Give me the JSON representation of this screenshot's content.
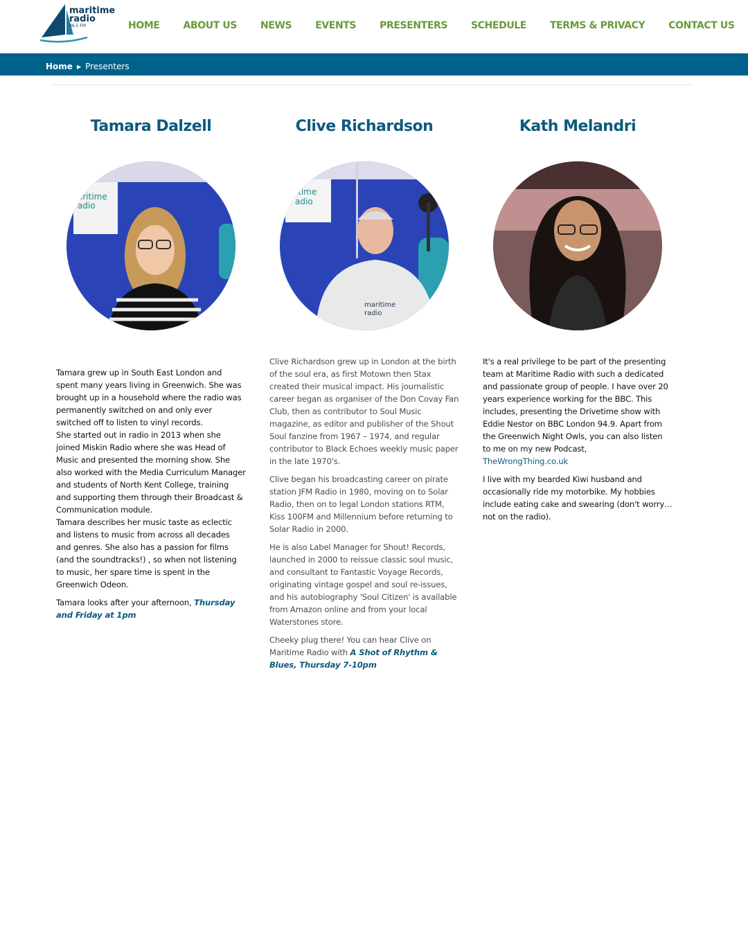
{
  "site": {
    "logo": {
      "line1": "maritime",
      "line2": "radio",
      "freq": "96.5 FM"
    },
    "nav": [
      "HOME",
      "ABOUT US",
      "NEWS",
      "EVENTS",
      "PRESENTERS",
      "SCHEDULE",
      "TERMS & PRIVACY",
      "CONTACT US"
    ],
    "colors": {
      "nav_green": "#6a9a3a",
      "bar_blue": "#00628a",
      "heading_blue": "#0d5a7e"
    }
  },
  "breadcrumb": {
    "home": "Home",
    "current": "Presenters"
  },
  "presenters": [
    {
      "name": "Tamara Dalzell",
      "lines": [
        "Tamara grew up in South East London and spent many years living in Greenwich. She was brought up in a household where the radio was permanently switched on and only ever switched off to listen to vinyl records.",
        "She started out in radio in 2013 when she joined Miskin Radio where she was Head of Music and presented the morning show. She also worked with the Media Curriculum Manager and students of North Kent College, training and supporting them through their Broadcast & Communication module.",
        "Tamara describes her music taste as eclectic and listens to music from across all decades and genres. She also has a passion for films (and the soundtracks!) , so when not listening to music, her spare time is spent in the Greenwich Odeon."
      ],
      "closing_text": "Tamara looks after your afternoon, ",
      "closing_link": "Thursday and Friday at 1pm"
    },
    {
      "name": "Clive Richardson",
      "paragraphs": [
        "Clive Richardson grew up in London at the birth of the soul era, as first Motown then Stax created their musical impact. His journalistic career began as organiser of the Don Covay Fan Club, then as contributor to Soul Music magazine, as editor and publisher of the Shout Soul fanzine from 1967 – 1974, and regular contributor to Black Echoes weekly music paper in the late 1970's.",
        "Clive began his broadcasting career on pirate station JFM Radio in 1980, moving on to Solar Radio, then on to legal London stations RTM, Kiss 100FM and Millennium before returning to Solar Radio in 2000.",
        "He is also Label Manager for Shout! Records, launched in 2000 to reissue classic soul music, and consultant to Fantastic Voyage Records, originating vintage gospel and soul re-issues, and his autobiography 'Soul Citizen' is available from Amazon online and from your local Waterstones store."
      ],
      "closing_text": "Cheeky plug there!  You can hear Clive on Maritime Radio with ",
      "closing_link": "A Shot of Rhythm & Blues, Thursday 7-10pm"
    },
    {
      "name": "Kath Melandri",
      "p1_text": "It's a real privilege to be part of the presenting team at Maritime Radio with such a dedicated and passionate group of people. I have over 20 years experience working for the BBC. This includes, presenting the Drivetime show with Eddie Nestor on BBC London 94.9. Apart from the Greenwich Night Owls, you can also listen to me on my new Podcast, ",
      "p1_link": "TheWrongThing.co.uk",
      "p2": "I live with my bearded Kiwi husband and occasionally ride my motorbike. My hobbies include eating cake and swearing (don't worry… not on the radio)."
    }
  ]
}
